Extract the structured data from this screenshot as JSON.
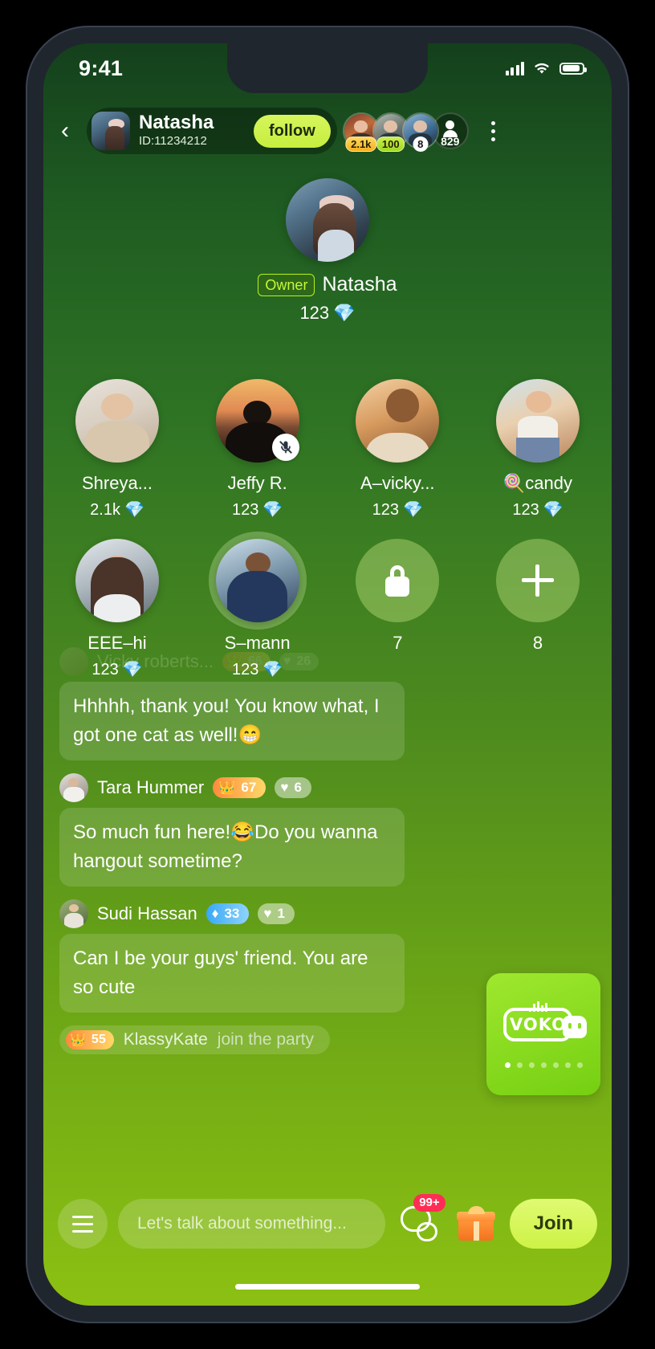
{
  "status_bar": {
    "time": "9:41",
    "signal_icon": "cellular-signal-icon",
    "wifi_icon": "wifi-icon",
    "battery_icon": "battery-icon"
  },
  "top_bar": {
    "back_icon": "back-chevron-icon",
    "host_name": "Natasha",
    "host_id": "ID:11234212",
    "follow_label": "follow",
    "more_icon": "more-vertical-icon",
    "viewers": [
      {
        "tag": "2.1k",
        "tag_style": "gold"
      },
      {
        "tag": "100",
        "tag_style": "green"
      },
      {
        "tag": "8",
        "tag_style": "white"
      }
    ],
    "viewer_count": "829"
  },
  "owner": {
    "badge": "Owner",
    "name": "Natasha",
    "gems": "123",
    "gem_icon": "💎"
  },
  "seats": [
    {
      "name": "Shreya...",
      "gems": "2.1k",
      "gem_icon": "💎",
      "type": "user",
      "muted": false,
      "speaking": false
    },
    {
      "name": "Jeffy R.",
      "gems": "123",
      "gem_icon": "💎",
      "type": "user",
      "muted": true,
      "speaking": false
    },
    {
      "name": "A–vicky...",
      "gems": "123",
      "gem_icon": "💎",
      "type": "user",
      "muted": false,
      "speaking": false
    },
    {
      "name": "🍭candy",
      "gems": "123",
      "gem_icon": "💎",
      "type": "user",
      "muted": false,
      "speaking": false
    },
    {
      "name": "EEE–hi",
      "gems": "123",
      "gem_icon": "💎",
      "type": "user",
      "muted": false,
      "speaking": false
    },
    {
      "name": "S–mann",
      "gems": "123",
      "gem_icon": "💎",
      "type": "user",
      "muted": false,
      "speaking": true
    },
    {
      "name": "7",
      "gems": "",
      "type": "locked",
      "icon": "lock-icon"
    },
    {
      "name": "8",
      "gems": "",
      "type": "add",
      "icon": "plus-icon"
    }
  ],
  "chat": {
    "faded_row": {
      "name": "Vicky roberts...",
      "badge_a": "66",
      "badge_b": "26"
    },
    "messages": [
      {
        "kind": "bubble",
        "text": "Hhhhh, thank you! You know what, I got one cat as well!😁"
      },
      {
        "kind": "header",
        "name": "Tara Hummer",
        "crown": "67",
        "hearts": "6"
      },
      {
        "kind": "bubble",
        "text": "So much fun here!😂Do you wanna hangout sometime?"
      },
      {
        "kind": "header",
        "name": "Sudi Hassan",
        "gems": "33",
        "hearts": "1"
      },
      {
        "kind": "bubble",
        "text": "Can I be your guys' friend. You are so cute"
      },
      {
        "kind": "system",
        "crown": "55",
        "name": "KlassyKate",
        "action": "join the party"
      }
    ]
  },
  "promo_card": {
    "logo_text": "VOKO",
    "dots_total": 7,
    "active_dot": 1
  },
  "bottom_bar": {
    "menu_icon": "hamburger-menu-icon",
    "input_placeholder": "Let's talk about something...",
    "chat_icon": "chat-bubbles-icon",
    "chat_badge": "99+",
    "gift_icon": "gift-icon",
    "join_label": "Join"
  },
  "colors": {
    "accent_green": "#cdf246",
    "bg_top": "#14401c",
    "bg_bottom": "#8cc013",
    "badge_red": "#ff2d55"
  }
}
